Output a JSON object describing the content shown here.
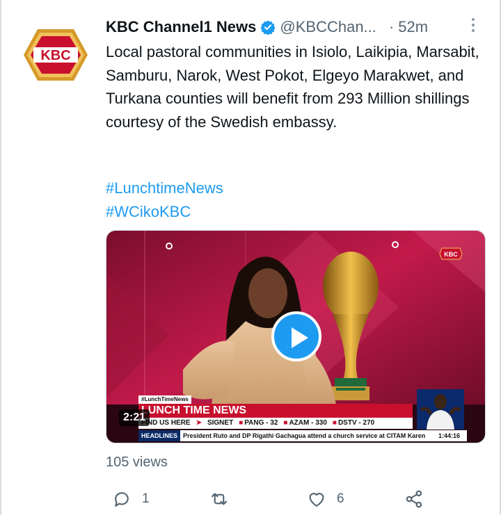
{
  "tweet": {
    "author_name": "KBC Channel1 News",
    "handle": "@KBCChan...",
    "separator": "·",
    "time": "52m",
    "avatar_logo": "KBC",
    "text": "Local pastoral communities in Isiolo, Laikipia, Marsabit, Samburu, Narok, West Pokot, Elgeyo Marakwet, and Turkana counties will benefit from 293 Million shillings courtesy of the Swedish embassy.",
    "hashtags": [
      "#LunchtimeNews",
      "#WCikoKBC"
    ]
  },
  "video": {
    "duration": "2:21",
    "channel_bug": "KBC",
    "lower_third": {
      "tag": "#LunchTimeNews",
      "title": "LUNCH TIME NEWS",
      "find_label": "FIND US HERE",
      "arrow": "➤",
      "channels": [
        "SIGNET",
        "PANG - 32",
        "AZAM - 330",
        "DSTV - 270"
      ]
    },
    "headline_bar": {
      "label": "HEADLINES",
      "text": "President Ruto and DP Rigathi Gachagua attend a church service at CITAM Karen",
      "time": "1:44:16"
    }
  },
  "stats": {
    "views": "105 views",
    "replies": "1",
    "retweets": "",
    "likes": "6"
  },
  "colors": {
    "link": "#1d9bf0",
    "muted": "#536471",
    "verified": "#1d9bf0",
    "kbc_red": "#c8102e"
  },
  "icons": [
    "verified-badge-icon",
    "more-icon",
    "play-icon",
    "reply-icon",
    "retweet-icon",
    "like-icon",
    "share-icon"
  ]
}
